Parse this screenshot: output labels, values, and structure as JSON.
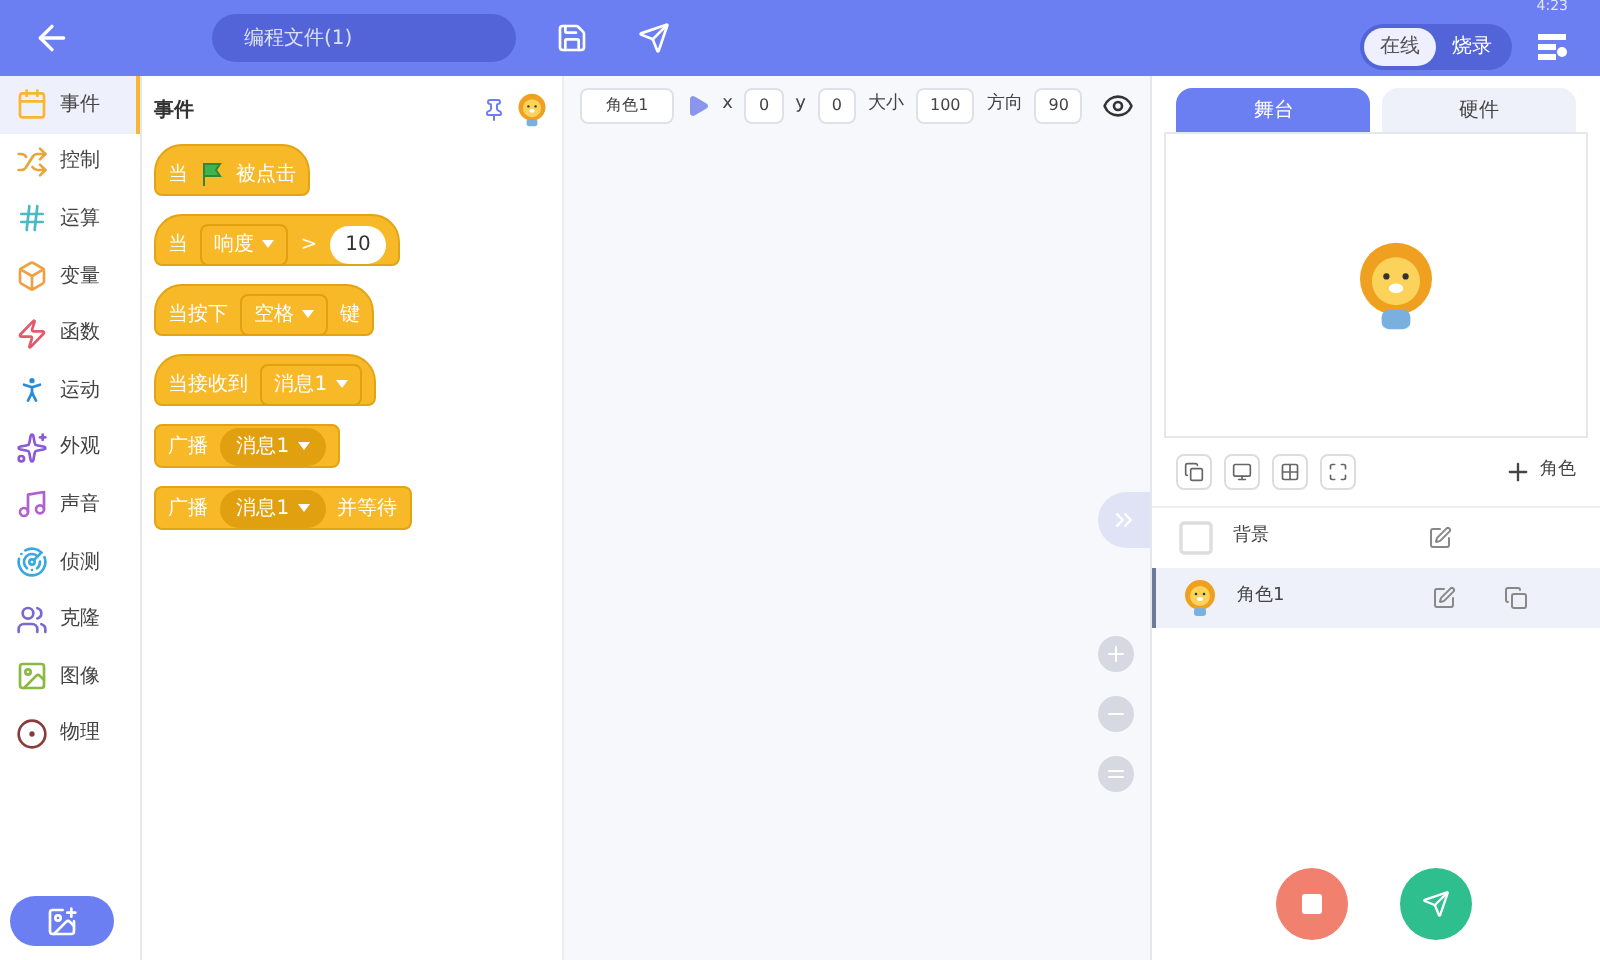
{
  "status_bar": {
    "time": "4:23"
  },
  "top_bar": {
    "file_name": "编程文件(1)",
    "mode_tabs": [
      {
        "label": "在线",
        "selected": true
      },
      {
        "label": "烧录",
        "selected": false
      }
    ]
  },
  "categories": [
    {
      "label": "事件",
      "selected": true,
      "color": "#f5b82e"
    },
    {
      "label": "控制",
      "selected": false,
      "color": "#e8a53a"
    },
    {
      "label": "运算",
      "selected": false,
      "color": "#4cb8c4"
    },
    {
      "label": "变量",
      "selected": false,
      "color": "#f0a040"
    },
    {
      "label": "函数",
      "selected": false,
      "color": "#e05a6a"
    },
    {
      "label": "运动",
      "selected": false,
      "color": "#2a8ad8"
    },
    {
      "label": "外观",
      "selected": false,
      "color": "#8a5ad8"
    },
    {
      "label": "声音",
      "selected": false,
      "color": "#b060d0"
    },
    {
      "label": "侦测",
      "selected": false,
      "color": "#3aa8e0"
    },
    {
      "label": "克隆",
      "selected": false,
      "color": "#7a6ad0"
    },
    {
      "label": "图像",
      "selected": false,
      "color": "#8ab840"
    },
    {
      "label": "物理",
      "selected": false,
      "color": "#8a3a3a"
    }
  ],
  "palette": {
    "title": "事件",
    "blocks": [
      {
        "kind": "hat",
        "parts": [
          {
            "kind": "text",
            "text": "当"
          },
          {
            "kind": "flag"
          },
          {
            "kind": "text",
            "text": "被点击"
          }
        ]
      },
      {
        "kind": "hat",
        "parts": [
          {
            "kind": "text",
            "text": "当"
          },
          {
            "kind": "field",
            "text": "响度"
          },
          {
            "kind": "text",
            "text": ">"
          },
          {
            "kind": "number",
            "text": "10"
          }
        ]
      },
      {
        "kind": "hat",
        "parts": [
          {
            "kind": "text",
            "text": "当按下"
          },
          {
            "kind": "field",
            "text": "空格"
          },
          {
            "kind": "text",
            "text": "键"
          }
        ]
      },
      {
        "kind": "hat",
        "parts": [
          {
            "kind": "text",
            "text": "当接收到"
          },
          {
            "kind": "field",
            "text": "消息1"
          }
        ]
      },
      {
        "kind": "stack",
        "parts": [
          {
            "kind": "text",
            "text": "广播"
          },
          {
            "kind": "reporter",
            "text": "消息1"
          }
        ]
      },
      {
        "kind": "stack",
        "parts": [
          {
            "kind": "text",
            "text": "广播"
          },
          {
            "kind": "reporter",
            "text": "消息1"
          },
          {
            "kind": "text",
            "text": "并等待"
          }
        ]
      }
    ]
  },
  "sprite_bar": {
    "name": "角色1",
    "fields": [
      {
        "label": "x",
        "value": "0"
      },
      {
        "label": "y",
        "value": "0"
      },
      {
        "label": "大小",
        "value": "100"
      },
      {
        "label": "方向",
        "value": "90"
      }
    ]
  },
  "stage_tabs": [
    {
      "label": "舞台",
      "selected": true
    },
    {
      "label": "硬件",
      "selected": false
    }
  ],
  "add_sprite": {
    "label": "角色"
  },
  "sprites": [
    {
      "kind": "backdrop",
      "name": "背景",
      "selected": false
    },
    {
      "kind": "sprite",
      "name": "角色1",
      "selected": true
    }
  ]
}
